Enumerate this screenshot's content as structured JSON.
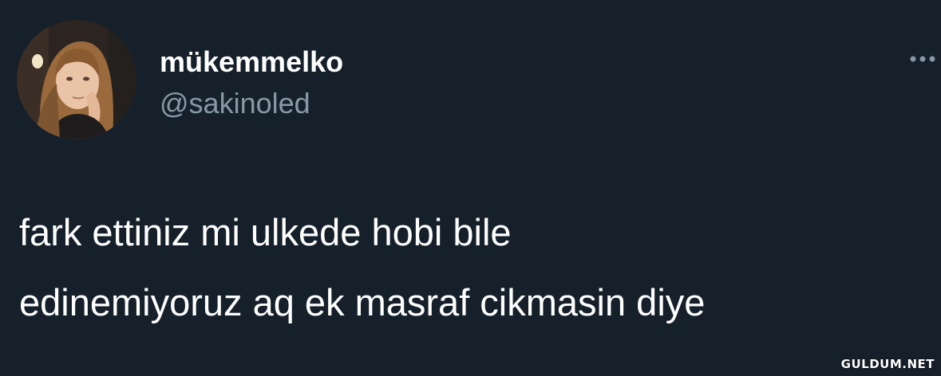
{
  "user": {
    "display_name": "mükemmelko",
    "handle": "@sakinoled",
    "avatar_icon": "user-avatar"
  },
  "more_menu": {
    "icon": "more-horizontal-icon"
  },
  "tweet": {
    "lines": [
      "fark ettiniz mi ulkede hobi bile",
      "edinemiyoruz aq ek masraf cikmasin diye"
    ]
  },
  "watermark": {
    "text": "GULDUM.NET"
  },
  "colors": {
    "background": "#15202b",
    "primary_text": "#ffffff",
    "secondary_text": "#8899a6"
  }
}
